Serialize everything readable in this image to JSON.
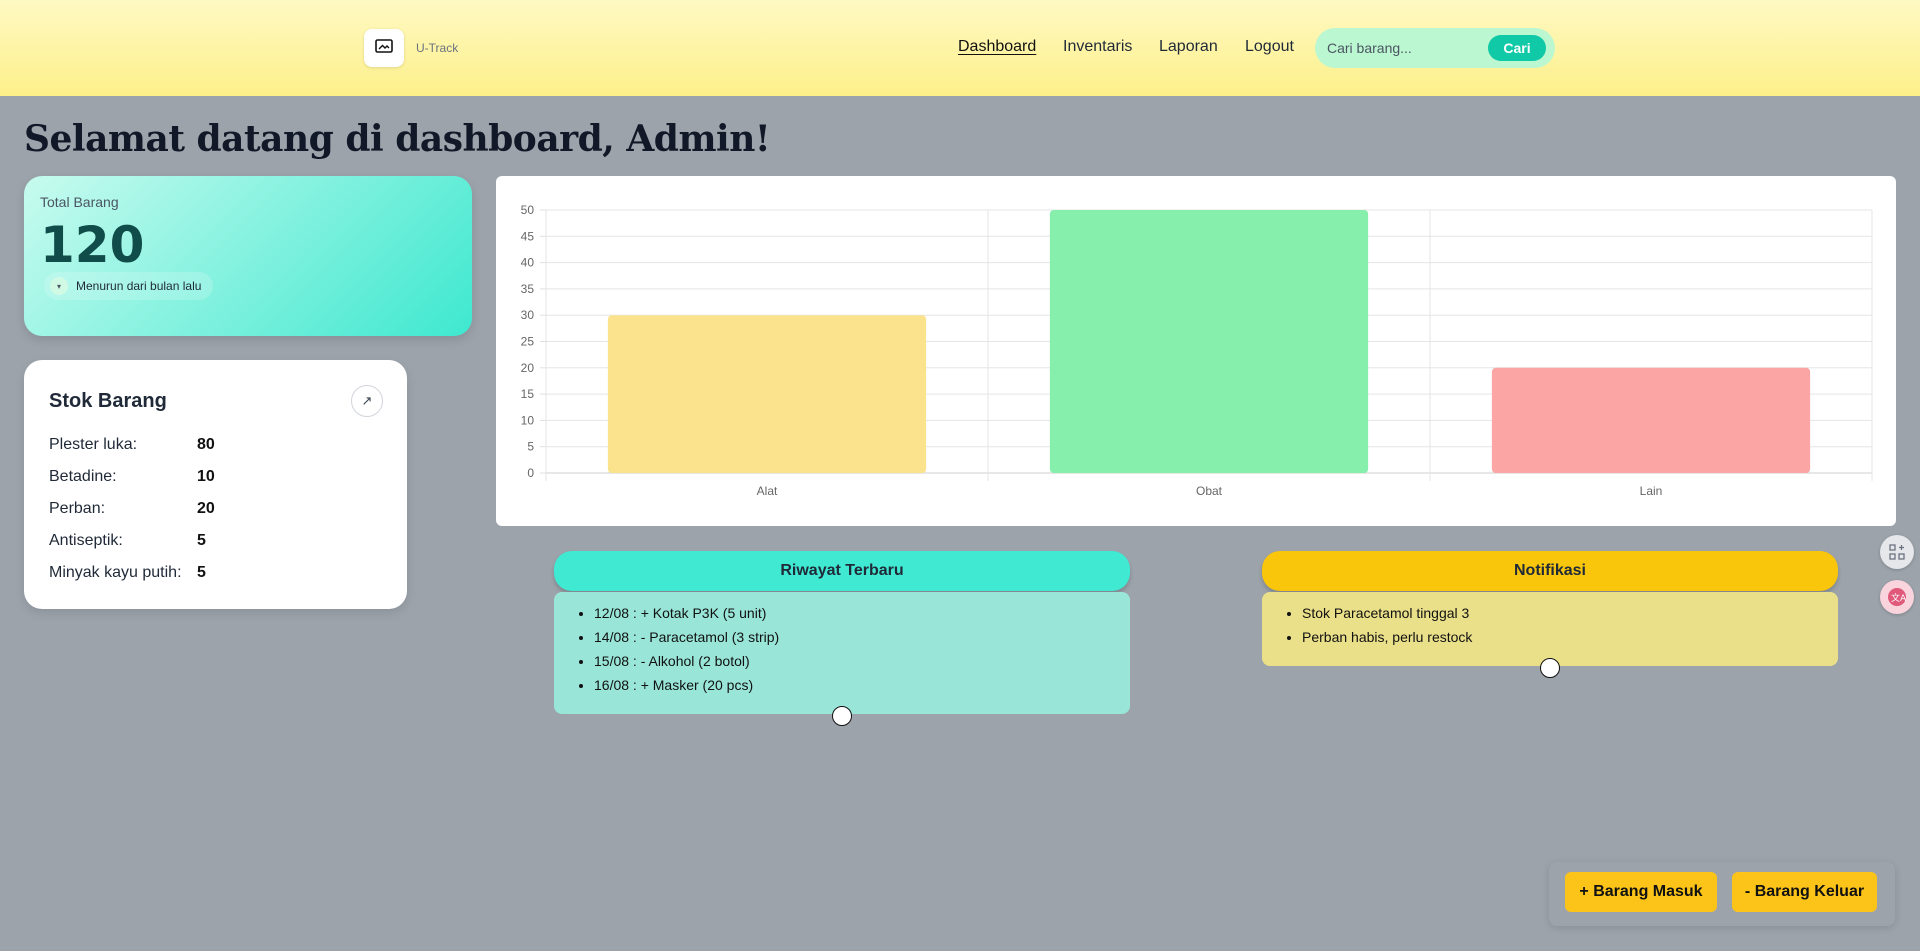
{
  "header": {
    "app_name": "U-Track",
    "logo_icon": "image-icon",
    "nav": [
      "Dashboard",
      "Inventaris",
      "Laporan",
      "Logout"
    ],
    "active_nav": "Dashboard",
    "search_placeholder": "Cari barang...",
    "search_button": "Cari"
  },
  "page_title": "Selamat datang di dashboard, Admin!",
  "total_card": {
    "label": "Total Barang",
    "value": "120",
    "trend_icon": "chevron-down-icon",
    "trend_text": "Menurun dari bulan lalu"
  },
  "stok_card": {
    "title": "Stok Barang",
    "link_icon": "arrow-up-right-icon",
    "items": [
      {
        "name": "Plester luka:",
        "value": "80"
      },
      {
        "name": "Betadine:",
        "value": "10"
      },
      {
        "name": "Perban:",
        "value": "20"
      },
      {
        "name": "Antiseptik:",
        "value": "5"
      },
      {
        "name": "Minyak kayu putih:",
        "value": "5"
      }
    ]
  },
  "chart_data": {
    "type": "bar",
    "categories": [
      "Alat",
      "Obat",
      "Lain"
    ],
    "values": [
      30,
      50,
      20
    ],
    "colors": [
      "#fbe38e",
      "#86efac",
      "#fca5a5"
    ],
    "yticks": [
      0,
      5,
      10,
      15,
      20,
      25,
      30,
      35,
      40,
      45,
      50
    ],
    "ylim": [
      0,
      50
    ],
    "grid": true,
    "legend": "none"
  },
  "riwayat": {
    "title": "Riwayat Terbaru",
    "items": [
      "12/08 : + Kotak P3K (5 unit)",
      "14/08 : - Paracetamol (3 strip)",
      "15/08 : - Alkohol (2 botol)",
      "16/08 : + Masker (20 pcs)"
    ],
    "head_color": "#40e9d2",
    "body_color": "#99e6d9"
  },
  "notifikasi": {
    "title": "Notifikasi",
    "items": [
      "Stok Paracetamol tinggal 3",
      "Perban habis, perlu restock"
    ],
    "head_color": "#fac60c",
    "body_color": "#ebe08a"
  },
  "side_buttons": [
    "grid-add-icon",
    "translate-icon"
  ],
  "actions": {
    "barang_masuk": "+ Barang Masuk",
    "barang_keluar": "- Barang Keluar"
  }
}
